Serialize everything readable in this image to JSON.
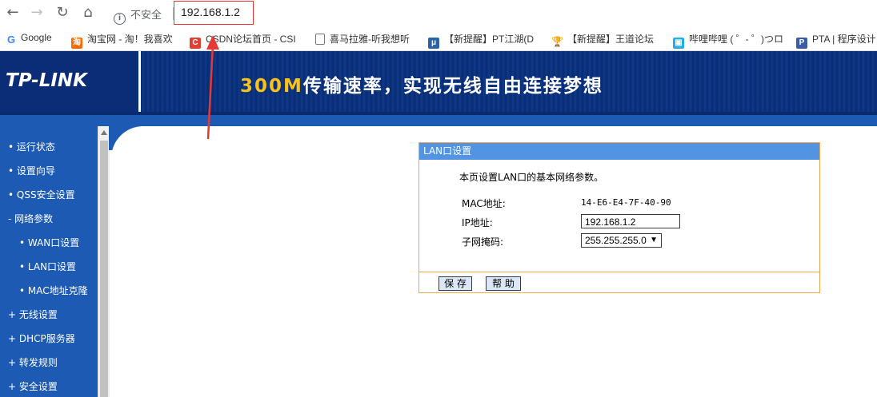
{
  "browser": {
    "security_label": "不安全",
    "url": "192.168.1.2",
    "icons": [
      "back-icon",
      "forward-icon",
      "reload-icon",
      "home-icon",
      "info-icon"
    ]
  },
  "bookmarks": [
    {
      "label": "Google",
      "icon": "google-icon"
    },
    {
      "label": "淘宝网 - 淘！我喜欢",
      "icon": "taobao-icon"
    },
    {
      "label": "CSDN论坛首页 - CSI",
      "icon": "csdn-icon"
    },
    {
      "label": "喜马拉雅-听我想听",
      "icon": "page-icon"
    },
    {
      "label": "【新提醒】PT江湖(D",
      "icon": "pt-icon"
    },
    {
      "label": "【新提醒】王道论坛",
      "icon": "trophy-icon"
    },
    {
      "label": "哔哩哔哩 ( ゜- ゜)つロ",
      "icon": "bilibili-icon"
    },
    {
      "label": "PTA | 程序设计",
      "icon": "pta-icon"
    }
  ],
  "banner": {
    "logo": "TP-LINK",
    "slogan_highlight": "300M",
    "slogan_rest": "传输速率，实现无线自由连接梦想"
  },
  "sidebar": {
    "items": [
      {
        "label": "• 运行状态"
      },
      {
        "label": "• 设置向导"
      },
      {
        "label": "• QSS安全设置"
      },
      {
        "label": "- 网络参数"
      },
      {
        "label": "• WAN口设置"
      },
      {
        "label": "• LAN口设置"
      },
      {
        "label": "• MAC地址克隆"
      },
      {
        "label": "+ 无线设置"
      },
      {
        "label": "+ DHCP服务器"
      },
      {
        "label": "+ 转发规则"
      },
      {
        "label": "+ 安全设置"
      }
    ]
  },
  "panel": {
    "title": "LAN口设置",
    "description": "本页设置LAN口的基本网络参数。",
    "mac_label": "MAC地址:",
    "mac_value": "14-E6-E4-7F-40-90",
    "ip_label": "IP地址:",
    "ip_value": "192.168.1.2",
    "mask_label": "子网掩码:",
    "mask_value": "255.255.255.0",
    "save_label": "保 存",
    "help_label": "帮 助"
  },
  "colors": {
    "sidebar": "#1c5ab4",
    "panel_title": "#5294e2",
    "panel_border": "#f2a84b",
    "annotation": "#e53935"
  }
}
